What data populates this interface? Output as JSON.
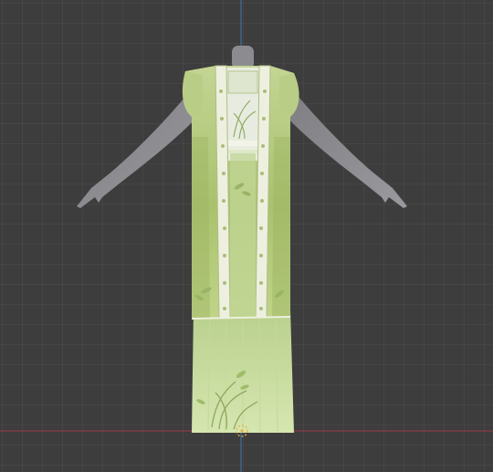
{
  "viewport": {
    "background_color": "#3d3d3d",
    "grid_color": "#4a4a4a",
    "axis_x_color": "#8a3d47",
    "axis_z_color": "#3f6da0"
  },
  "model": {
    "mannequin_color": "#8c8c90",
    "robe_color": "#b9cf86",
    "robe_shadow_color": "#8ca655",
    "skirt_color": "#cfe2a6",
    "trim_color": "#eef0df",
    "inner_panel_color": "#e8ece0"
  },
  "gizmo": {
    "icon": "origin-point-icon",
    "color": "#e8b040"
  }
}
